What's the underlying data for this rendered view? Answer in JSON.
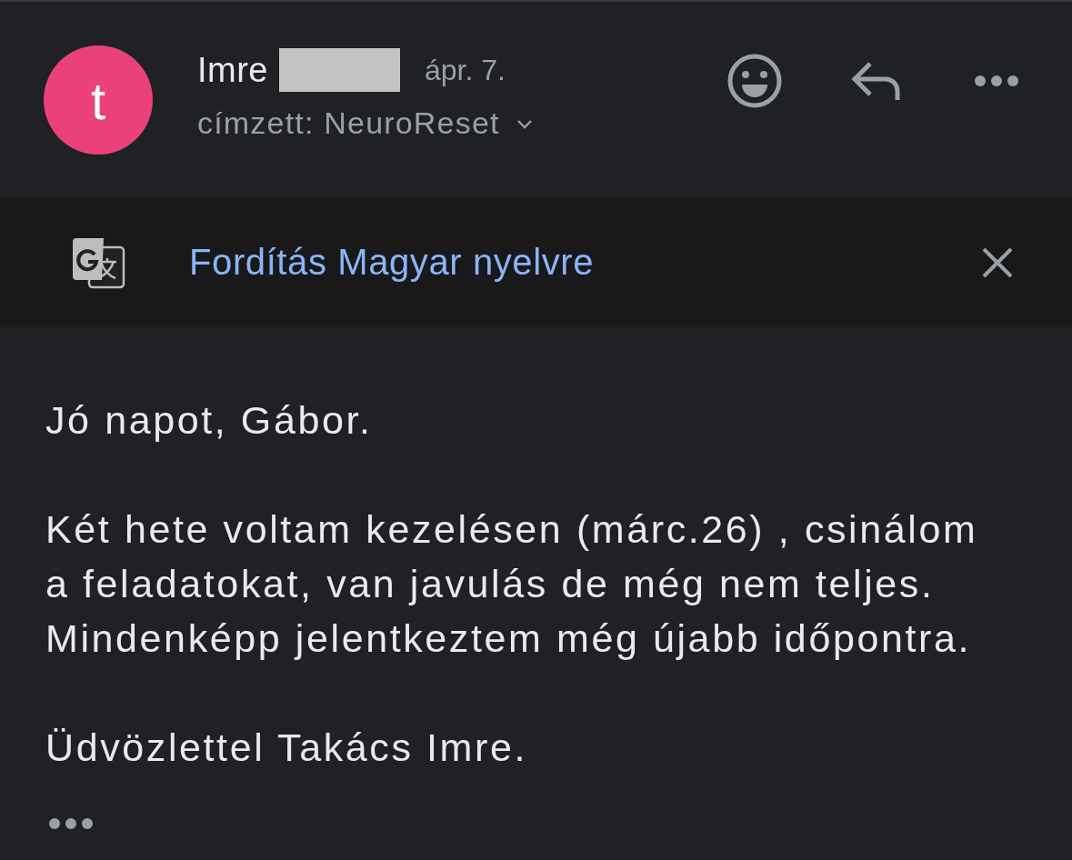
{
  "message_header": {
    "avatar_letter": "t",
    "sender_name": "Imre",
    "date": "ápr. 7.",
    "recipient": "címzett: NeuroReset"
  },
  "translate_bar": {
    "label": "Fordítás Magyar nyelvre"
  },
  "message_body": {
    "paragraphs": [
      {
        "lines": [
          "Jó napot, Gábor."
        ]
      },
      {
        "lines": [
          "Két hete voltam kezelésen (márc.26) , csinálom",
          "a feladatokat, van javulás de még nem teljes.",
          "Mindenképp jelentkeztem még újabb időpontra."
        ]
      },
      {
        "lines": [
          "Üdvözlettel Takács Imre."
        ]
      }
    ]
  }
}
